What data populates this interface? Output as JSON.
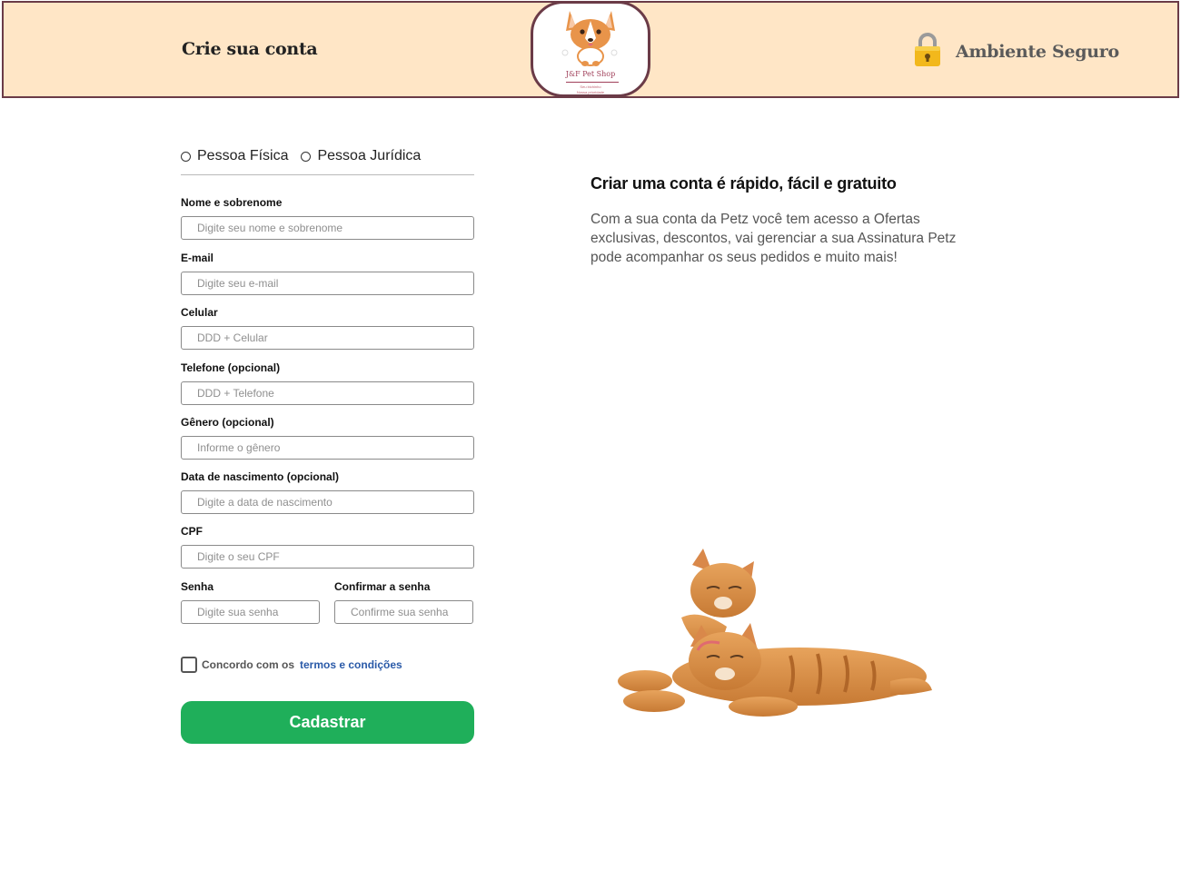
{
  "header": {
    "title": "Crie sua conta",
    "logo": {
      "name": "J&F Pet Shop",
      "tagline_line1": "Seu bichinho",
      "tagline_line2": "Nossa prioridade"
    },
    "secure_label": "Ambiente Seguro",
    "icons": {
      "secure": "padlock-icon",
      "logo": "corgi-dog-logo"
    }
  },
  "form": {
    "person_types": [
      "Pessoa Física",
      "Pessoa Jurídica"
    ],
    "fields": [
      {
        "label": "Nome e sobrenome",
        "placeholder": "Digite seu nome e sobrenome",
        "value": ""
      },
      {
        "label": "E-mail",
        "placeholder": "Digite seu e-mail",
        "value": ""
      },
      {
        "label": "Celular",
        "placeholder": "DDD + Celular",
        "value": ""
      },
      {
        "label": "Telefone (opcional)",
        "placeholder": "DDD + Telefone",
        "value": ""
      },
      {
        "label": "Gênero (opcional)",
        "placeholder": "Informe o gênero",
        "value": ""
      },
      {
        "label": "Data de nascimento (opcional)",
        "placeholder": "Digite a data de nascimento",
        "value": ""
      },
      {
        "label": "CPF",
        "placeholder": "Digite o seu CPF",
        "value": ""
      }
    ],
    "password": {
      "label": "Senha",
      "placeholder": "Digite sua senha",
      "value": ""
    },
    "confirm_password": {
      "label": "Confirmar a senha",
      "placeholder": "Confirme sua senha",
      "value": ""
    },
    "agree_text": "Concordo com os",
    "terms_link": "termos e condições",
    "submit_label": "Cadastrar"
  },
  "info": {
    "title": "Criar uma conta é rápido, fácil e gratuito",
    "text": "Com a sua conta da Petz você tem acesso a Ofertas exclusivas, descontos, vai gerenciar a sua Assinatura Petz pode acompanhar os seus pedidos e muito mais!",
    "image": "two-orange-kittens"
  },
  "colors": {
    "header_bg": "#ffe6c6",
    "header_border": "#6b3b47",
    "submit": "#1faf5a",
    "link": "#2a5aa8"
  }
}
